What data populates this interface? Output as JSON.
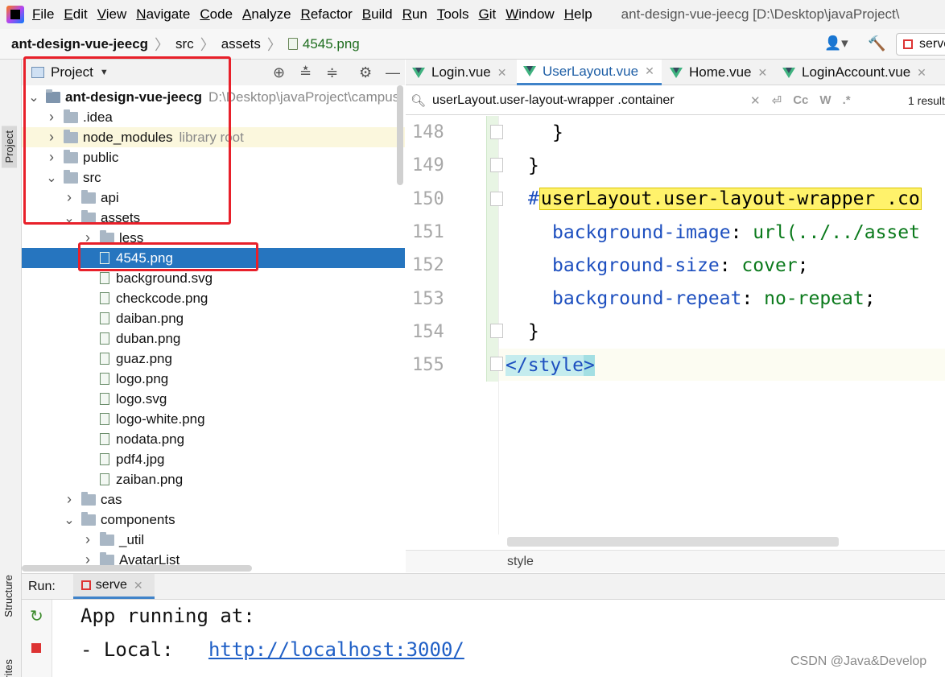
{
  "menubar": {
    "items": [
      "File",
      "Edit",
      "View",
      "Navigate",
      "Code",
      "Analyze",
      "Refactor",
      "Build",
      "Run",
      "Tools",
      "Git",
      "Window",
      "Help"
    ],
    "window_title": "ant-design-vue-jeecg [D:\\Desktop\\javaProject\\"
  },
  "navbar": {
    "crumbs": [
      "ant-design-vue-jeecg",
      "src",
      "assets",
      "4545.png"
    ],
    "run_config": "serve"
  },
  "left_strip": {
    "project": "Project",
    "structure": "Structure",
    "favorites": "Favorites"
  },
  "project_panel": {
    "title": "Project",
    "tree": [
      {
        "label": "ant-design-vue-jeecg",
        "hint": "D:\\Desktop\\javaProject\\campus",
        "type": "root",
        "depth": 0,
        "expanded": true
      },
      {
        "label": ".idea",
        "type": "folder",
        "depth": 1,
        "expanded": false
      },
      {
        "label": "node_modules",
        "hint": "library root",
        "type": "folder",
        "depth": 1,
        "expanded": false,
        "highlight": true
      },
      {
        "label": "public",
        "type": "folder",
        "depth": 1,
        "expanded": false
      },
      {
        "label": "src",
        "type": "folder",
        "depth": 1,
        "expanded": true
      },
      {
        "label": "api",
        "type": "folder",
        "depth": 2,
        "expanded": false
      },
      {
        "label": "assets",
        "type": "folder",
        "depth": 2,
        "expanded": true
      },
      {
        "label": "less",
        "type": "folder",
        "depth": 3,
        "expanded": false
      },
      {
        "label": "4545.png",
        "type": "file",
        "depth": 3,
        "selected": true
      },
      {
        "label": "background.svg",
        "type": "file",
        "depth": 3
      },
      {
        "label": "checkcode.png",
        "type": "file",
        "depth": 3
      },
      {
        "label": "daiban.png",
        "type": "file",
        "depth": 3
      },
      {
        "label": "duban.png",
        "type": "file",
        "depth": 3
      },
      {
        "label": "guaz.png",
        "type": "file",
        "depth": 3
      },
      {
        "label": "logo.png",
        "type": "file",
        "depth": 3
      },
      {
        "label": "logo.svg",
        "type": "file",
        "depth": 3
      },
      {
        "label": "logo-white.png",
        "type": "file",
        "depth": 3
      },
      {
        "label": "nodata.png",
        "type": "file",
        "depth": 3
      },
      {
        "label": "pdf4.jpg",
        "type": "file",
        "depth": 3
      },
      {
        "label": "zaiban.png",
        "type": "file",
        "depth": 3
      },
      {
        "label": "cas",
        "type": "folder",
        "depth": 2,
        "expanded": false
      },
      {
        "label": "components",
        "type": "folder",
        "depth": 2,
        "expanded": true
      },
      {
        "label": "_util",
        "type": "folder",
        "depth": 3,
        "expanded": false
      },
      {
        "label": "AvatarList",
        "type": "folder",
        "depth": 3,
        "expanded": false
      }
    ]
  },
  "editor": {
    "tabs": [
      {
        "label": "Login.vue",
        "active": false
      },
      {
        "label": "UserLayout.vue",
        "active": true
      },
      {
        "label": "Home.vue",
        "active": false
      },
      {
        "label": "LoginAccount.vue",
        "active": false
      }
    ],
    "search": {
      "value": "userLayout.user-layout-wrapper .container",
      "match_case": "Cc",
      "words": "W",
      "regex": ".*",
      "count": "1 result"
    },
    "line_numbers": [
      "148",
      "149",
      "150",
      "151",
      "152",
      "153",
      "154",
      "155"
    ],
    "code": {
      "l148": "}",
      "l149": "}",
      "l150_hash": "#",
      "l150_sel": "userLayout.user-layout-wrapper .co",
      "l151_prop": "background-image",
      "l151_val": "url(../../asset",
      "l152_prop": "background-size",
      "l152_val": "cover",
      "l153_prop": "background-repeat",
      "l153_val": "no-repeat",
      "l154": "}",
      "l155_open": "</",
      "l155_tag": "style",
      "l155_close": ">"
    },
    "breadcrumb": "style"
  },
  "run_panel": {
    "label": "Run:",
    "tab": "serve",
    "console": {
      "line1": "App running at:",
      "line2_prefix": "- Local:   ",
      "line2_link": "http://localhost:3000/"
    }
  },
  "watermark": "CSDN @Java&Develop",
  "colors": {
    "selection": "#2675bf",
    "annotation_red": "#e8202a",
    "search_highlight": "#fff26b"
  }
}
